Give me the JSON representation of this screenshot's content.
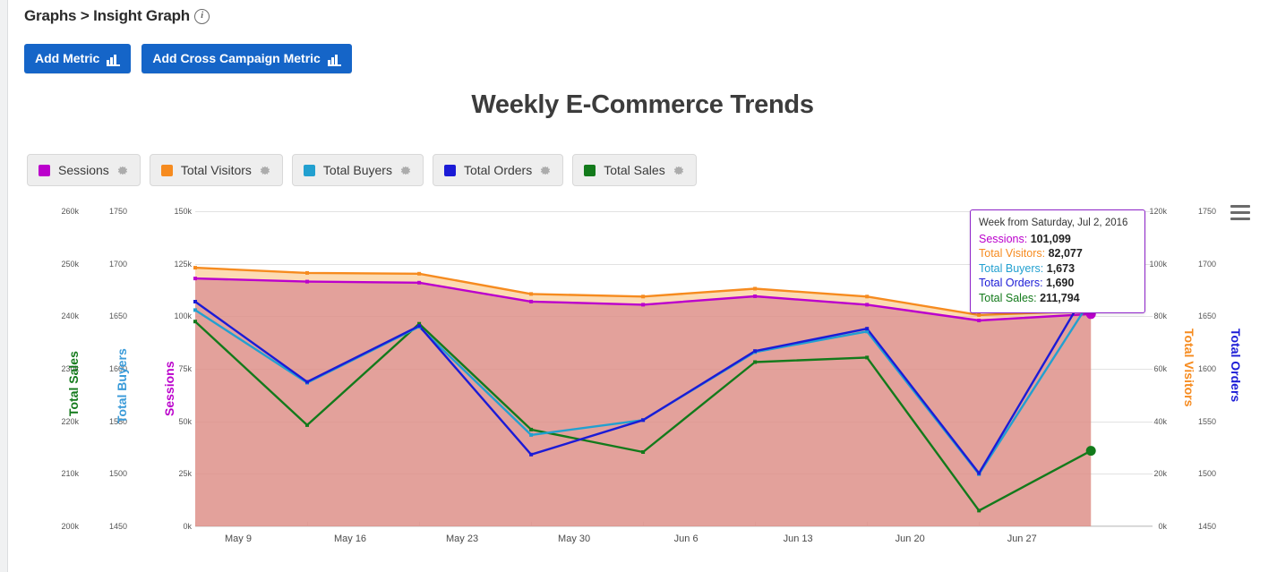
{
  "header": {
    "breadcrumb": "Graphs > Insight Graph",
    "info_icon": "info-icon",
    "buttons": [
      {
        "label": "Add Metric",
        "icon": "bar-chart-icon"
      },
      {
        "label": "Add Cross Campaign Metric",
        "icon": "bar-chart-icon"
      }
    ]
  },
  "chart_title": "Weekly E-Commerce Trends",
  "legend": [
    {
      "label": "Sessions",
      "color": "#bb00cc",
      "gear": "gear-icon"
    },
    {
      "label": "Total Visitors",
      "color": "#f68b1f",
      "gear": "gear-icon"
    },
    {
      "label": "Total Buyers",
      "color": "#22a0d0",
      "gear": "gear-icon"
    },
    {
      "label": "Total Orders",
      "color": "#1b1bd6",
      "gear": "gear-icon"
    },
    {
      "label": "Total Sales",
      "color": "#137a1b",
      "gear": "gear-icon"
    }
  ],
  "tooltip": {
    "title": "Week from Saturday, Jul 2, 2016",
    "rows": [
      {
        "label": "Sessions:",
        "value": "101,099",
        "color": "#bb00cc"
      },
      {
        "label": "Total Visitors:",
        "value": "82,077",
        "color": "#f68b1f"
      },
      {
        "label": "Total Buyers:",
        "value": "1,673",
        "color": "#22a0d0"
      },
      {
        "label": "Total Orders:",
        "value": "1,690",
        "color": "#1b1bd6"
      },
      {
        "label": "Total Sales:",
        "value": "211,794",
        "color": "#137a1b"
      }
    ]
  },
  "menu_icon": "hamburger-menu-icon",
  "chart_data": {
    "type": "line",
    "title": "Weekly E-Commerce Trends",
    "xlabel": "",
    "grid": true,
    "legend_position": "top-left",
    "x": [
      "May 9",
      "May 16",
      "May 23",
      "May 30",
      "Jun 6",
      "Jun 13",
      "Jun 20",
      "Jun 27",
      "Jul 2"
    ],
    "xticks": [
      "May 9",
      "May 16",
      "May 23",
      "May 30",
      "Jun 6",
      "Jun 13",
      "Jun 20",
      "Jun 27"
    ],
    "axes": [
      {
        "name": "Total Sales",
        "color": "#137a1b",
        "ticks": [
          "200k",
          "210k",
          "220k",
          "230k",
          "240k",
          "250k",
          "260k"
        ],
        "min": 195000,
        "max": 265000,
        "side": "left"
      },
      {
        "name": "Total Buyers",
        "color": "#3a9bd9",
        "ticks": [
          "1450",
          "1500",
          "1550",
          "1600",
          "1650",
          "1700",
          "1750"
        ],
        "min": 1430,
        "max": 1768,
        "side": "left"
      },
      {
        "name": "Sessions",
        "color": "#bb00cc",
        "ticks": [
          "0k",
          "25k",
          "50k",
          "75k",
          "100k",
          "125k",
          "150k"
        ],
        "min": 0,
        "max": 150000,
        "side": "left"
      },
      {
        "name": "Total Visitors",
        "color": "#f68b1f",
        "ticks": [
          "0k",
          "20k",
          "40k",
          "60k",
          "80k",
          "100k",
          "120k"
        ],
        "min": 0,
        "max": 120000,
        "side": "right"
      },
      {
        "name": "Total Orders",
        "color": "#1b1bd6",
        "ticks": [
          "1450",
          "1500",
          "1550",
          "1600",
          "1650",
          "1700",
          "1750"
        ],
        "min": 1430,
        "max": 1768,
        "side": "right"
      }
    ],
    "series": [
      {
        "name": "Sessions",
        "color": "#bb00cc",
        "axis": "Sessions",
        "unit": "",
        "values": [
          118000,
          116500,
          116000,
          107000,
          105500,
          109500,
          105500,
          98000,
          101099
        ]
      },
      {
        "name": "Total Visitors",
        "color": "#f68b1f",
        "axis": "Total Visitors",
        "unit": "",
        "values": [
          98500,
          96500,
          96200,
          88500,
          87500,
          90500,
          87500,
          80500,
          82077
        ]
      },
      {
        "name": "Total Buyers",
        "color": "#22a0d0",
        "axis": "Total Buyers",
        "unit": "",
        "values": [
          1662,
          1584,
          1644,
          1528,
          1544,
          1617,
          1639,
          1486,
          1673
        ]
      },
      {
        "name": "Total Orders",
        "color": "#1b1bd6",
        "axis": "Total Orders",
        "unit": "",
        "values": [
          1671,
          1585,
          1645,
          1507,
          1544,
          1618,
          1642,
          1487,
          1690
        ]
      },
      {
        "name": "Total Sales",
        "color": "#137a1b",
        "axis": "Total Sales",
        "unit": "",
        "values": [
          240500,
          217500,
          240000,
          216500,
          211500,
          231500,
          232500,
          198500,
          211794
        ]
      }
    ]
  }
}
